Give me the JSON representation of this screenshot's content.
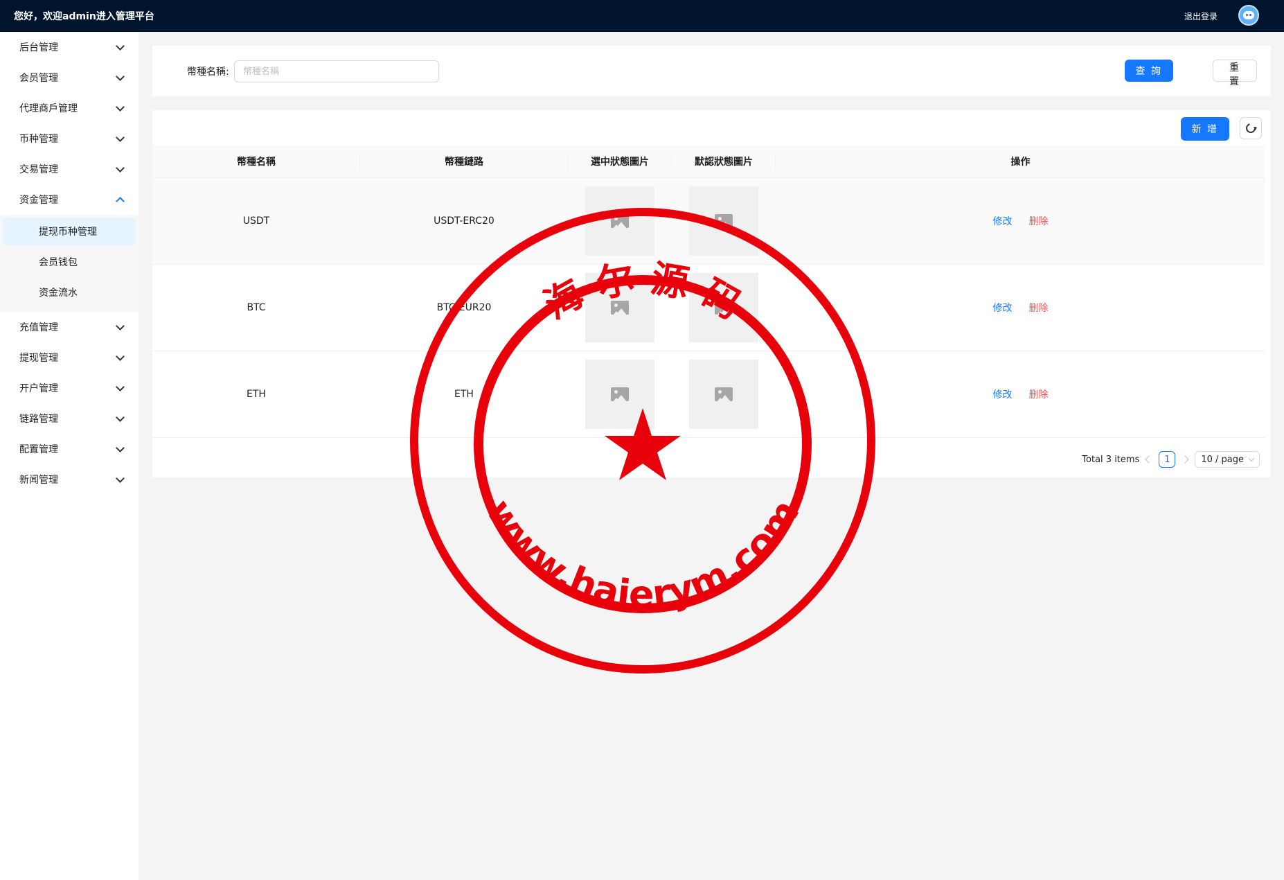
{
  "header": {
    "welcome": "您好，欢迎admin进入管理平台",
    "logout": "退出登录"
  },
  "sidebar": {
    "items": [
      {
        "label": "后台管理"
      },
      {
        "label": "会员管理"
      },
      {
        "label": "代理商戶管理"
      },
      {
        "label": "币种管理"
      },
      {
        "label": "交易管理"
      },
      {
        "label": "资金管理",
        "open": true
      },
      {
        "label": "充值管理"
      },
      {
        "label": "提现管理"
      },
      {
        "label": "开户管理"
      },
      {
        "label": "链路管理"
      },
      {
        "label": "配置管理"
      },
      {
        "label": "新闻管理"
      }
    ],
    "submenu": [
      {
        "label": "提现币种管理",
        "active": true
      },
      {
        "label": "会员钱包"
      },
      {
        "label": "资金流水"
      }
    ]
  },
  "search": {
    "label": "幣種名稱:",
    "placeholder": "幣種名稱",
    "value": "",
    "query_label": "查 詢",
    "reset_label": "重 置"
  },
  "toolbar": {
    "add_label": "新 增"
  },
  "table": {
    "columns": [
      "幣種名稱",
      "幣種鏈路",
      "選中狀態圖片",
      "默認狀態圖片",
      "操作"
    ],
    "rows": [
      {
        "name": "USDT",
        "chain": "USDT-ERC20",
        "edit": "修改",
        "delete": "删除"
      },
      {
        "name": "BTC",
        "chain": "BTC-EUR20",
        "edit": "修改",
        "delete": "删除"
      },
      {
        "name": "ETH",
        "chain": "ETH",
        "edit": "修改",
        "delete": "删除"
      }
    ]
  },
  "pagination": {
    "total": "Total 3 items",
    "current": "1",
    "page_size": "10 / page"
  },
  "watermark": {
    "top_text": "海 尔 源 码",
    "bottom_text": "www.haierym.com",
    "color": "#e8000b"
  },
  "colors": {
    "topbar": "#00142d",
    "primary": "#1677ff",
    "danger": "#ff4d4f"
  }
}
